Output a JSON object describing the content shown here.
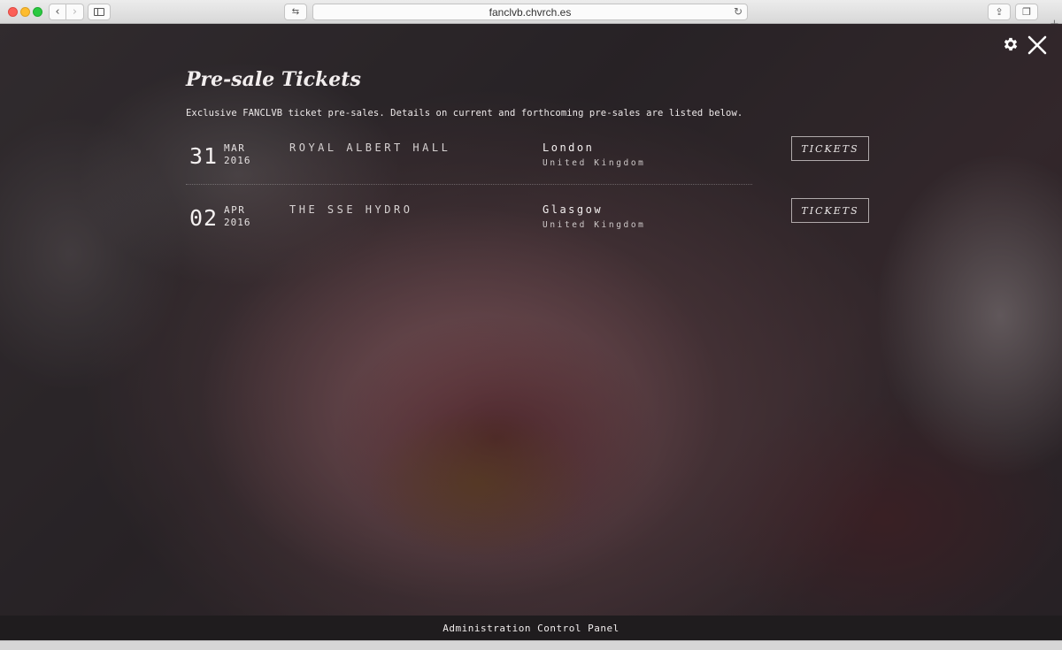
{
  "browser": {
    "url": "fanclvb.chvrch.es",
    "back_glyph": "‹",
    "forward_glyph": "›",
    "reader_glyph": "⇆",
    "reload_glyph": "↻",
    "share_glyph": "⇪",
    "tabs_glyph": "❐",
    "newtab_glyph": "+"
  },
  "header": {
    "title": "Pre-sale Tickets",
    "description": "Exclusive FANCLVB ticket pre-sales. Details on current and forthcoming pre-sales are listed below."
  },
  "events": [
    {
      "day": "31",
      "month": "MAR",
      "year": "2016",
      "venue": "ROYAL ALBERT HALL",
      "city": "London",
      "country": "United Kingdom",
      "button_label": "TICKETS"
    },
    {
      "day": "02",
      "month": "APR",
      "year": "2016",
      "venue": "THE SSE HYDRO",
      "city": "Glasgow",
      "country": "United Kingdom",
      "button_label": "TICKETS"
    }
  ],
  "footer": {
    "label": "Administration Control Panel"
  },
  "icons": {
    "settings": "gear-icon",
    "close": "close-icon"
  },
  "colors": {
    "text": "#f2eeee",
    "footer_bg": "#1f1c1e"
  }
}
